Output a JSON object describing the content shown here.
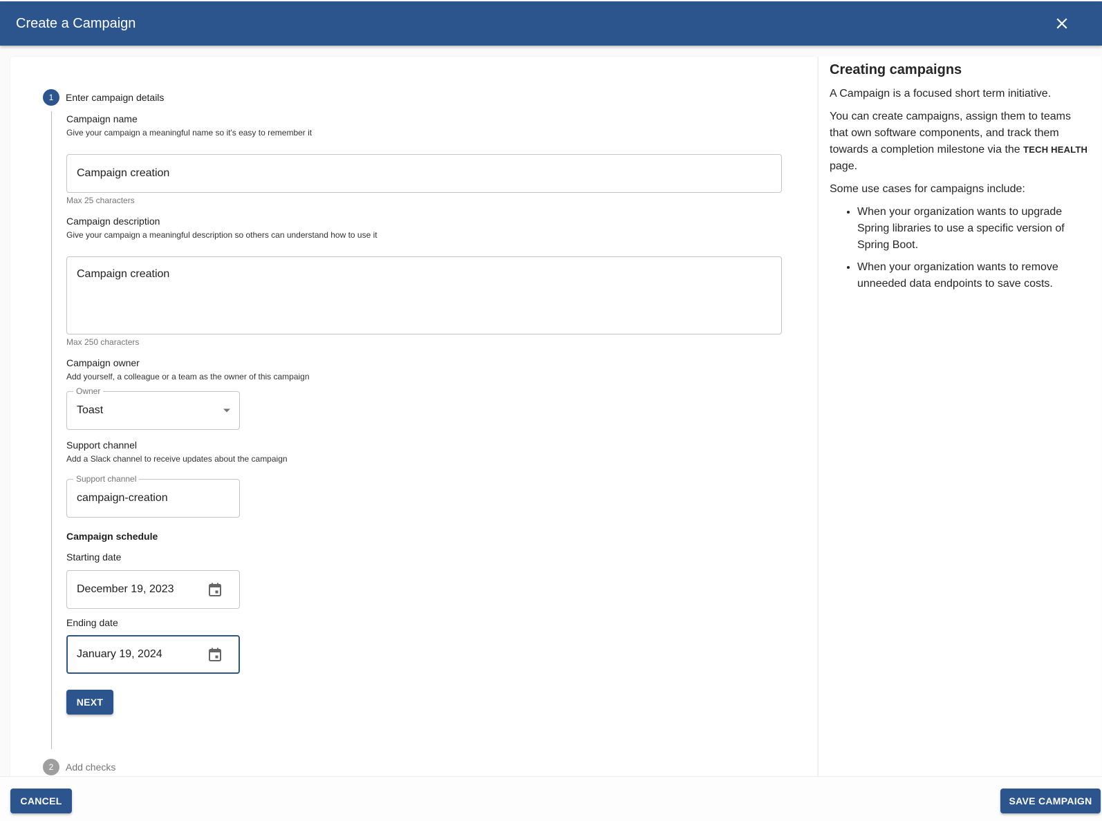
{
  "header": {
    "title": "Create a Campaign",
    "close_icon": "close-icon"
  },
  "stepper": {
    "steps": [
      {
        "number": "1",
        "label": "Enter campaign details",
        "state": "active"
      },
      {
        "number": "2",
        "label": "Add checks",
        "state": "inactive"
      }
    ]
  },
  "form": {
    "name": {
      "title": "Campaign name",
      "description": "Give your campaign a meaningful name so it's easy to remember it",
      "value": "Campaign creation",
      "helper": "Max 25 characters"
    },
    "description": {
      "title": "Campaign description",
      "description": "Give your campaign a meaningful description so others can understand how to use it",
      "value": "Campaign creation",
      "helper": "Max 250 characters"
    },
    "owner": {
      "title": "Campaign owner",
      "description": "Add yourself, a colleague or a team as the owner of this campaign",
      "label": "Owner",
      "value": "Toast",
      "icon": "arrow-drop-down-icon"
    },
    "support_channel": {
      "title": "Support channel",
      "description": "Add a Slack channel to receive updates about the campaign",
      "label": "Support channel",
      "value": "campaign-creation"
    },
    "schedule": {
      "title": "Campaign schedule",
      "start": {
        "label": "Starting date",
        "value": "December 19, 2023",
        "icon": "calendar-icon"
      },
      "end": {
        "label": "Ending date",
        "value": "January 19, 2024",
        "icon": "calendar-icon"
      }
    },
    "next_label": "NEXT"
  },
  "help": {
    "title": "Creating campaigns",
    "intro": "A Campaign is a focused short term initiative.",
    "body_prefix": "You can create campaigns, assign them to teams that own software components, and track them towards a completion milestone via the",
    "link_text": "TECH HEALTH",
    "body_suffix": "page.",
    "use_cases_intro": "Some use cases for campaigns include:",
    "use_cases": [
      "When your organization wants to upgrade Spring libraries to use a specific version of Spring Boot.",
      "When your organization wants to remove unneeded data endpoints to save costs."
    ]
  },
  "footer": {
    "cancel_label": "CANCEL",
    "save_label": "SAVE CAMPAIGN"
  },
  "colors": {
    "primary": "#2c548d",
    "inactive_step": "#9e9e9e"
  }
}
